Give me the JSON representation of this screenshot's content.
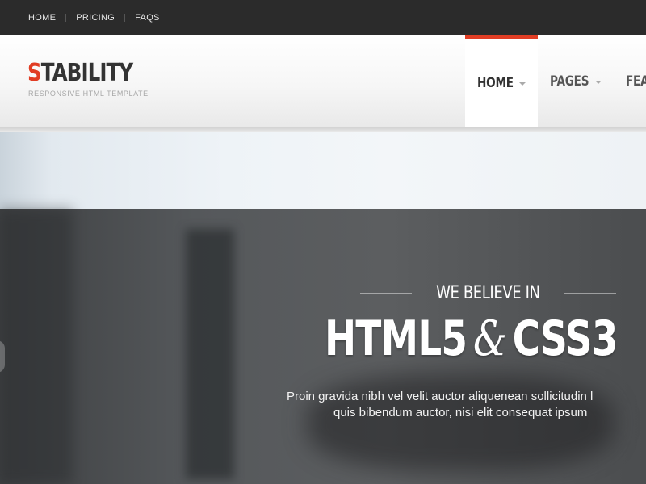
{
  "topbar": {
    "links": [
      "HOME",
      "PRICING",
      "FAQS"
    ]
  },
  "header": {
    "logo_first": "S",
    "logo_rest": "TABILITY",
    "tagline": "RESPONSIVE HTML TEMPLATE",
    "accent_color": "#e13d24"
  },
  "nav": {
    "items": [
      {
        "label": "HOME",
        "active": true
      },
      {
        "label": "PAGES",
        "active": false
      },
      {
        "label": "FEAT",
        "active": false
      }
    ]
  },
  "hero": {
    "eyebrow": "WE BELIEVE IN",
    "headline_part1": "HTML5",
    "headline_amp": "&",
    "headline_part2": "CSS3",
    "desc_line1": "Proin gravida nibh vel velit auctor aliquenean sollicitudin l",
    "desc_line2": "quis bibendum auctor, nisi elit consequat ipsum"
  }
}
